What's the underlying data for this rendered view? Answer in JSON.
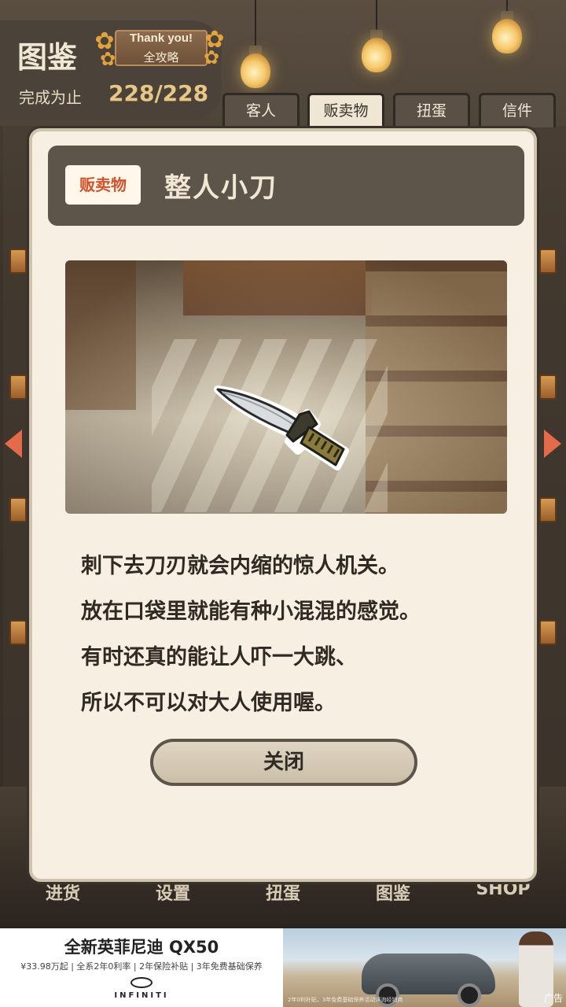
{
  "header": {
    "title": "图鉴",
    "ribbon_thanks": "Thank you!",
    "ribbon_complete": "全攻略",
    "progress_label": "完成为止",
    "progress_value": "228/228"
  },
  "tabs": [
    {
      "label": "客人",
      "active": false
    },
    {
      "label": "贩卖物",
      "active": true
    },
    {
      "label": "扭蛋",
      "active": false
    },
    {
      "label": "信件",
      "active": false
    }
  ],
  "bottom_nav": [
    "进货",
    "设置",
    "扭蛋",
    "图鉴",
    "SHOP"
  ],
  "modal": {
    "category": "贩卖物",
    "item_name": "整人小刀",
    "description": [
      "刺下去刀刃就会内缩的惊人机关。",
      "放在口袋里就能有种小混混的感觉。",
      "有时还真的能让人吓一大跳、",
      "所以不可以对大人使用喔。"
    ],
    "close_label": "关闭",
    "image_icon": "knife-icon"
  },
  "ad": {
    "headline": "全新英菲尼迪 QX50",
    "subline": "¥33.98万起 | 全系2年0利率 | 2年保险补贴 | 3年免费基础保养",
    "brand": "INFINITI",
    "tag": "广告",
    "fineprint": "2年0利补贴，3年免费基础保养活动详询经销商"
  },
  "colors": {
    "modal_bg": "#f7f0e2",
    "header_bar": "#5d544a",
    "accent_badge_text": "#d0552f",
    "progress_gold": "#e7c686",
    "arrow": "#e36b4a"
  }
}
